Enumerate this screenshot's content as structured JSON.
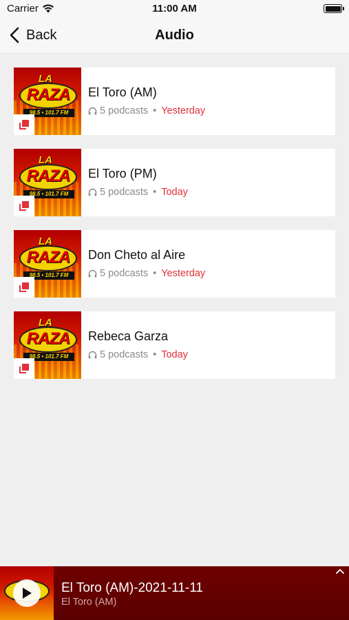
{
  "status_bar": {
    "carrier": "Carrier",
    "time": "11:00 AM"
  },
  "nav": {
    "back_label": "Back",
    "title": "Audio"
  },
  "list": {
    "items": [
      {
        "title": "El Toro (AM)",
        "count": "5 podcasts",
        "date": "Yesterday"
      },
      {
        "title": "El Toro (PM)",
        "count": "5 podcasts",
        "date": "Today"
      },
      {
        "title": "Don Cheto al Aire",
        "count": "5 podcasts",
        "date": "Yesterday"
      },
      {
        "title": "Rebeca Garza",
        "count": "5 podcasts",
        "date": "Today"
      }
    ],
    "separator": "•",
    "thumb_text": {
      "la": "LA",
      "raza": "RAZA",
      "freq": "98.5 • 101.7 FM"
    }
  },
  "player": {
    "title": "El Toro (AM)-2021-11-11",
    "subtitle": "El Toro (AM)"
  },
  "colors": {
    "accent": "#e0303a",
    "player_bg": "#5a0000",
    "background": "#efefef"
  }
}
